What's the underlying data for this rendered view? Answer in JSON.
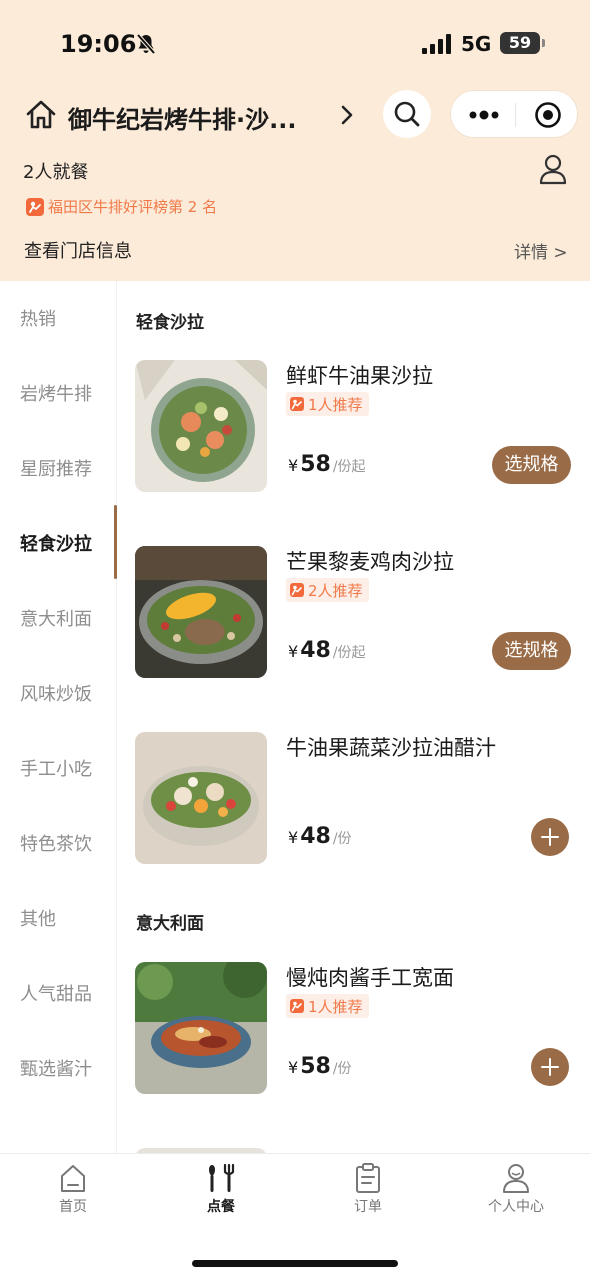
{
  "status_bar": {
    "time": "19:06",
    "network": "5G",
    "battery": "59"
  },
  "header": {
    "store_name": "御牛纪岩烤牛排·沙...",
    "diners": "2人就餐",
    "ranking": "福田区牛排好评榜第 2 名",
    "store_info": "查看门店信息",
    "details": "详情 >"
  },
  "sidebar": {
    "items": [
      {
        "label": "热销"
      },
      {
        "label": "岩烤牛排"
      },
      {
        "label": "星厨推荐"
      },
      {
        "label": "轻食沙拉",
        "active": true
      },
      {
        "label": "意大利面"
      },
      {
        "label": "风味炒饭"
      },
      {
        "label": "手工小吃"
      },
      {
        "label": "特色茶饮"
      },
      {
        "label": "其他"
      },
      {
        "label": "人气甜品"
      },
      {
        "label": "甄选酱汁"
      }
    ]
  },
  "menu": {
    "sections": [
      {
        "title": "轻食沙拉",
        "dishes": [
          {
            "name": "鲜虾牛油果沙拉",
            "tag": "1人推荐",
            "currency": "¥",
            "price": "58",
            "unit": "/份起",
            "action": "选规格"
          },
          {
            "name": "芒果黎麦鸡肉沙拉",
            "tag": "2人推荐",
            "currency": "¥",
            "price": "48",
            "unit": "/份起",
            "action": "选规格"
          },
          {
            "name": "牛油果蔬菜沙拉油醋汁",
            "currency": "¥",
            "price": "48",
            "unit": "/份"
          }
        ]
      },
      {
        "title": "意大利面",
        "dishes": [
          {
            "name": "慢炖肉酱手工宽面",
            "tag": "1人推荐",
            "currency": "¥",
            "price": "58",
            "unit": "/份"
          }
        ]
      }
    ]
  },
  "tabbar": {
    "tabs": [
      {
        "label": "首页",
        "icon": "home-tab-icon"
      },
      {
        "label": "点餐",
        "icon": "utensils-icon",
        "active": true
      },
      {
        "label": "订单",
        "icon": "clipboard-icon"
      },
      {
        "label": "个人中心",
        "icon": "user-icon"
      }
    ]
  },
  "colors": {
    "header_bg": "#fcebd9",
    "accent": "#9a6b47",
    "tag_orange": "#f26a3c"
  }
}
